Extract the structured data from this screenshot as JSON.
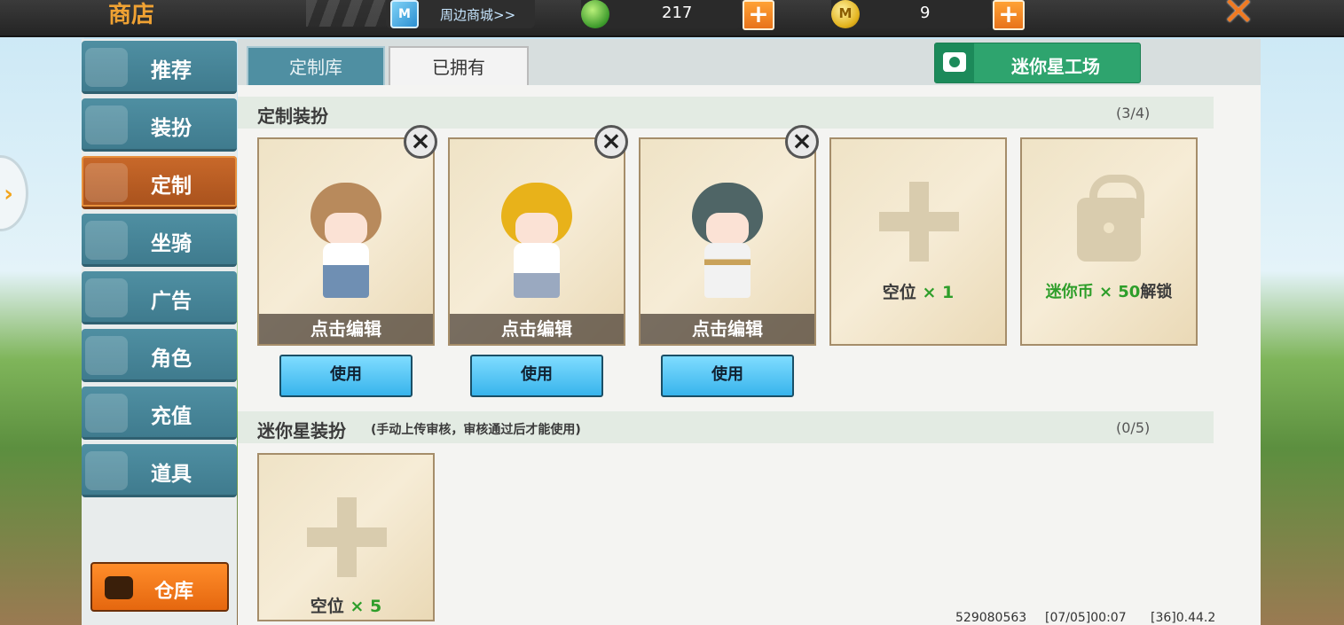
{
  "topbar": {
    "title": "商店",
    "mall_link": "周边商城>>",
    "mall_icon_text": "M",
    "gems": "217",
    "coins": "9",
    "coin_icon_text": "M",
    "plus_label": "+",
    "close_label": "✕",
    "icons": {
      "gem": "gem-icon",
      "coin": "coin-icon",
      "close": "close-icon"
    }
  },
  "sidebar": {
    "items": [
      {
        "label": "推荐",
        "icon": "thumbs-up-icon"
      },
      {
        "label": "装扮",
        "icon": "shirt-icon"
      },
      {
        "label": "定制",
        "icon": "custom-edit-icon",
        "active": true
      },
      {
        "label": "坐骑",
        "icon": "mount-icon"
      },
      {
        "label": "广告",
        "icon": "gift-ad-icon"
      },
      {
        "label": "角色",
        "icon": "character-icon"
      },
      {
        "label": "充值",
        "icon": "coin-stack-icon"
      },
      {
        "label": "道具",
        "icon": "item-icon"
      }
    ],
    "warehouse_label": "仓库",
    "handle_glyph": "›"
  },
  "tabs": [
    {
      "label": "定制库",
      "selected": true
    },
    {
      "label": "已拥有",
      "selected": false
    }
  ],
  "workshop_button": {
    "label": "迷你星工场",
    "icon": "camera-icon"
  },
  "custom_section": {
    "title": "定制装扮",
    "count": "(3/4)",
    "cards": [
      {
        "edit_label": "点击编辑",
        "use_label": "使用"
      },
      {
        "edit_label": "点击编辑",
        "use_label": "使用"
      },
      {
        "edit_label": "点击编辑",
        "use_label": "使用"
      }
    ],
    "empty_slot": {
      "label": "空位",
      "count": "× 1"
    },
    "locked_slot": {
      "prefix": "迷你币",
      "count": "× 50",
      "suffix": "解锁"
    }
  },
  "mini_section": {
    "title": "迷你星装扮",
    "note": "(手动上传审核，审核通过后才能使用)",
    "count": "(0/5)",
    "empty_slot": {
      "label": "空位",
      "count": "× 5"
    }
  },
  "footer": {
    "uid": "529080563",
    "datetime": "[07/05]00:07",
    "version": "[36]0.44.2"
  },
  "colors": {
    "accent_orange": "#e8731a",
    "nav_blue": "#4f8fa2",
    "active_nav": "#c9692a",
    "workshop_green": "#2ea46e",
    "use_button": "#38b4ec",
    "highlight_green": "#2e9e2a"
  }
}
